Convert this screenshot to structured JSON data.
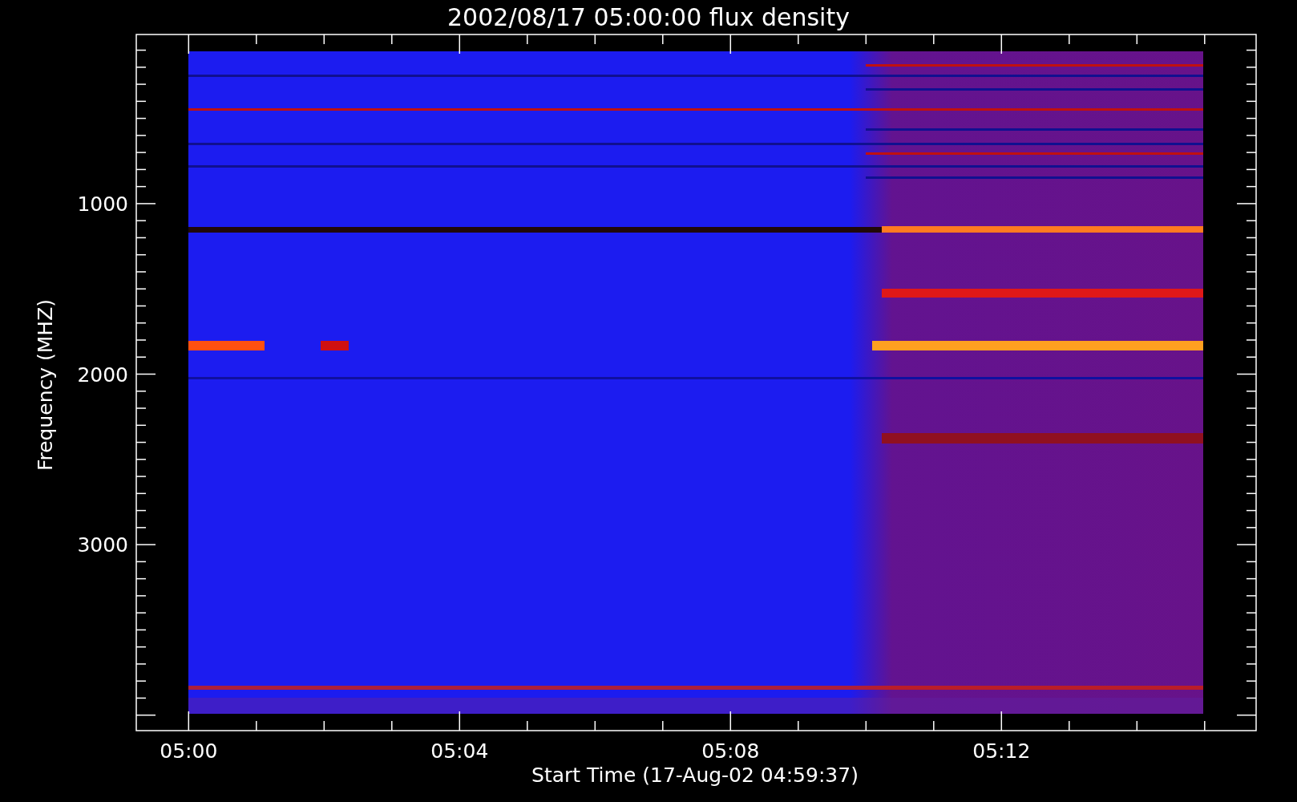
{
  "title": "2002/08/17 05:00:00 flux density",
  "y_axis": {
    "label": "Frequency (MHZ)",
    "ticks": [
      "1000",
      "2000",
      "3000"
    ]
  },
  "x_axis": {
    "label": "Start Time (17-Aug-02 04:59:37)",
    "ticks": [
      "05:00",
      "05:04",
      "05:08",
      "05:12"
    ]
  }
}
